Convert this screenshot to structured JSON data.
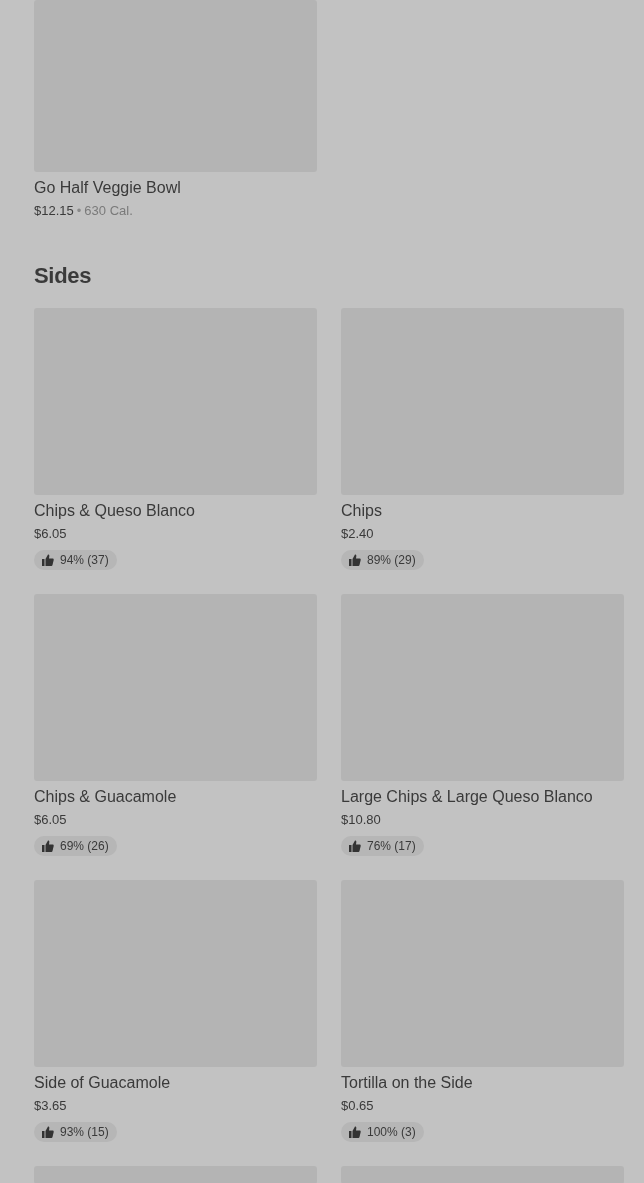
{
  "top_item": {
    "kind": "picture",
    "name": "Go Half Veggie Bowl",
    "price": "$12.15",
    "separator": "•",
    "calories": "630 Cal."
  },
  "section": {
    "title": "Sides",
    "items": [
      {
        "kind": "picture",
        "name": "Chips & Queso Blanco",
        "price": "$6.05",
        "rating": "94% (37)"
      },
      {
        "kind": "picture",
        "name": "Chips",
        "price": "$2.40",
        "rating": "89% (29)"
      },
      {
        "kind": "picture",
        "name": "Chips & Guacamole",
        "price": "$6.05",
        "rating": "69% (26)"
      },
      {
        "kind": "picture",
        "name": "Large Chips & Large Queso Blanco",
        "price": "$10.80",
        "rating": "76% (17)"
      },
      {
        "kind": "picture",
        "name": "Side of Guacamole",
        "price": "$3.65",
        "rating": "93% (15)"
      },
      {
        "kind": "picture",
        "name": "Tortilla on the Side",
        "price": "$0.65",
        "rating": "100% (3)"
      },
      {
        "kind": "picture"
      },
      {
        "kind": "picture"
      }
    ]
  }
}
